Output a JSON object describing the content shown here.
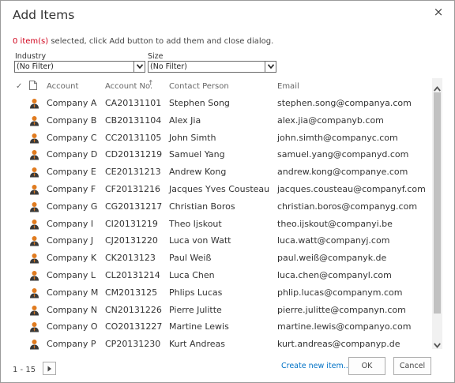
{
  "dialog": {
    "title": "Add Items",
    "close_glyph": "×"
  },
  "status": {
    "count_text": "0 item(s)",
    "message": " selected, click Add button to add them and close dialog."
  },
  "filters": {
    "industry": {
      "label": "Industry",
      "selected": "(No Filter)"
    },
    "size": {
      "label": "Size",
      "selected": "(No Filter)"
    }
  },
  "grid": {
    "headers": {
      "check": "✓",
      "account": "Account",
      "account_no": "Account No.",
      "sort_indicator": "↑",
      "contact": "Contact Person",
      "email": "Email"
    },
    "rows": [
      {
        "account": "Company A",
        "account_no": "CA20131101",
        "contact": "Stephen Song",
        "email": "stephen.song@companya.com"
      },
      {
        "account": "Company B",
        "account_no": "CB20131104",
        "contact": "Alex Jia",
        "email": "alex.jia@companyb.com"
      },
      {
        "account": "Company C",
        "account_no": "CC20131105",
        "contact": "John Simth",
        "email": "john.simth@companyc.com"
      },
      {
        "account": "Company D",
        "account_no": "CD20131219",
        "contact": "Samuel Yang",
        "email": "samuel.yang@companyd.com"
      },
      {
        "account": "Company E",
        "account_no": "CE20131213",
        "contact": "Andrew Kong",
        "email": "andrew.kong@companye.com"
      },
      {
        "account": "Company F",
        "account_no": "CF20131216",
        "contact": "Jacques Yves Cousteau",
        "email": "jacques.cousteau@companyf.com"
      },
      {
        "account": "Company G",
        "account_no": "CG20131217",
        "contact": "Christian Boros",
        "email": "christian.boros@companyg.com"
      },
      {
        "account": "Company I",
        "account_no": "CI20131219",
        "contact": "Theo Ijskout",
        "email": "theo.ijskout@companyi.be"
      },
      {
        "account": "Company J",
        "account_no": "CJ20131220",
        "contact": "Luca von Watt",
        "email": "luca.watt@companyj.com"
      },
      {
        "account": "Company K",
        "account_no": "CK2013123",
        "contact": "Paul Weiß",
        "email": "paul.weiß@companyk.de"
      },
      {
        "account": "Company L",
        "account_no": "CL20131214",
        "contact": "Luca Chen",
        "email": "luca.chen@companyl.com"
      },
      {
        "account": "Company M",
        "account_no": "CM2013125",
        "contact": "Phlips Lucas",
        "email": "phlip.lucas@companym.com"
      },
      {
        "account": "Company N",
        "account_no": "CN20131226",
        "contact": "Pierre Julitte",
        "email": "pierre.julitte@companyn.com"
      },
      {
        "account": "Company O",
        "account_no": "CO20131227",
        "contact": "Martine Lewis",
        "email": "martine.lewis@companyo.com"
      },
      {
        "account": "Company P",
        "account_no": "CP20131230",
        "contact": "Kurt Andreas",
        "email": "kurt.andreas@companyp.de"
      }
    ],
    "row_icon": "person-icon"
  },
  "footer": {
    "pager_text": "1 - 15",
    "create_link": "Create new item...",
    "ok_label": "OK",
    "cancel_label": "Cancel"
  },
  "colors": {
    "selected_count": "#d0021b",
    "link": "#0072c6",
    "icon_head": "#e07b1f",
    "icon_body": "#3a3a3a"
  }
}
